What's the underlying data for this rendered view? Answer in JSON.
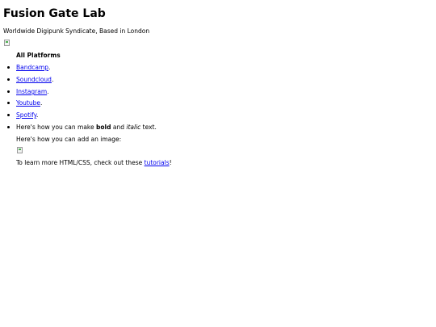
{
  "header": {
    "title": "Fusion Gate Lab",
    "tagline": "Worldwide Digipunk Syndicate, Based in London"
  },
  "platforms": {
    "heading": "All Platforms",
    "links": [
      {
        "label": "Bandcamp",
        "suffix": "."
      },
      {
        "label": "Soundcloud",
        "suffix": "."
      },
      {
        "label": "Instagram",
        "suffix": "."
      },
      {
        "label": "Youtube",
        "suffix": "."
      },
      {
        "label": "Spotify",
        "suffix": "."
      }
    ]
  },
  "formatting": {
    "prefix": "Here's how you can make ",
    "bold": "bold",
    "middle": " and ",
    "italic": "italic",
    "suffix": " text."
  },
  "image_note": "Here's how you can add an image:",
  "learn_more": {
    "prefix": "To learn more HTML/CSS, check out these ",
    "link": "tutorials",
    "suffix": "!"
  },
  "colors": {
    "link": "#0000ee",
    "text": "#000000",
    "background": "#ffffff"
  },
  "icons": {
    "broken_image": "broken-image-icon"
  }
}
